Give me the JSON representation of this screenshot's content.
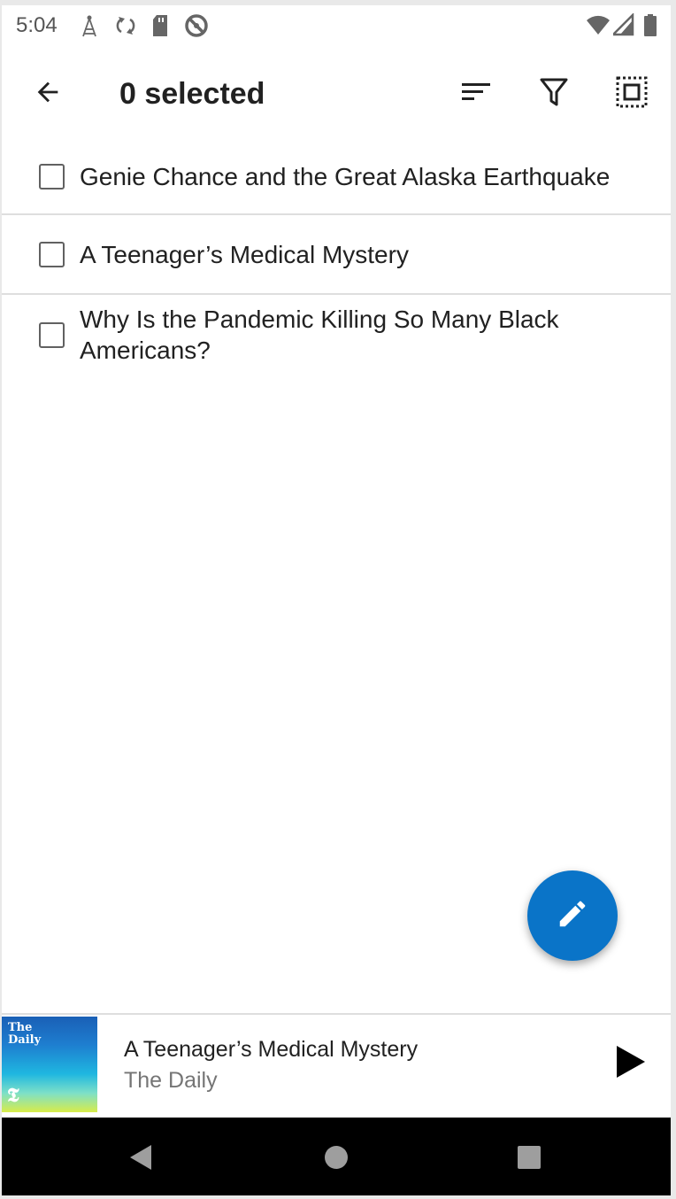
{
  "status_bar": {
    "time": "5:04",
    "left_icons": [
      "antenna-icon",
      "sync-icon",
      "sd-card-icon",
      "blocked-icon"
    ],
    "right_icons": [
      "wifi-icon",
      "signal-icon",
      "battery-icon"
    ]
  },
  "toolbar": {
    "title": "0 selected",
    "icons": [
      "back-arrow-icon",
      "sort-icon",
      "filter-icon",
      "select-all-icon"
    ]
  },
  "list": {
    "items": [
      {
        "label": "Genie Chance and the Great Alaska Earthquake",
        "checked": false
      },
      {
        "label": "A Teenager’s Medical Mystery",
        "checked": false
      },
      {
        "label": "Why Is the Pandemic Killing So Many Black Americans?",
        "checked": false
      }
    ]
  },
  "fab": {
    "icon": "edit-pencil-icon",
    "color": "#0a74c8"
  },
  "player": {
    "cover_text": "The Daily",
    "cover_logo": "𝕿",
    "title": "A Teenager’s Medical Mystery",
    "subtitle": "The Daily",
    "play_icon": "play-icon"
  },
  "nav_bar": {
    "icons": [
      "nav-back-icon",
      "nav-home-icon",
      "nav-recents-icon"
    ]
  }
}
